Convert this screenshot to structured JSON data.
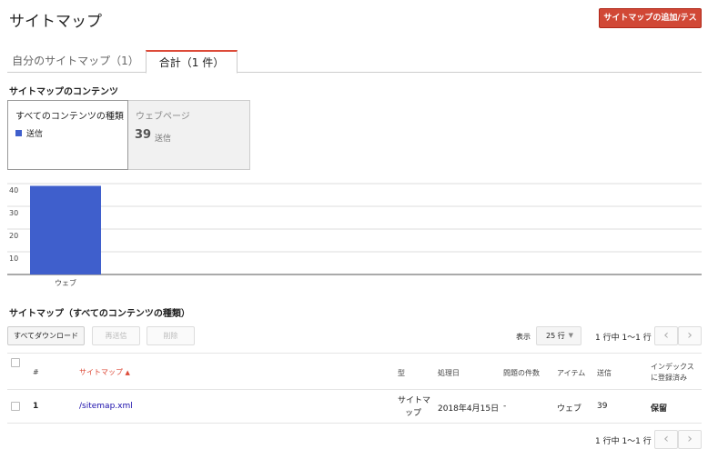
{
  "header": {
    "title": "サイトマップ",
    "add_button": "サイトマップの追加/テスト"
  },
  "tabs": [
    {
      "label": "自分のサイトマップ（1）"
    },
    {
      "label": "合計（1 件）"
    }
  ],
  "content_section": {
    "title": "サイトマップのコンテンツ",
    "cards": [
      {
        "label": "すべてのコンテンツの種類",
        "legend": "送信"
      },
      {
        "label": "ウェブページ",
        "count": "39",
        "unit": "送信"
      }
    ]
  },
  "chart_data": {
    "type": "bar",
    "categories": [
      "ウェブ"
    ],
    "series": [
      {
        "name": "送信",
        "values": [
          39
        ]
      }
    ],
    "yticks": [
      10,
      20,
      30,
      40
    ],
    "ylim": [
      0,
      40
    ],
    "color": "#3f5fcc",
    "grid": true
  },
  "table_section": {
    "title": "サイトマップ（すべてのコンテンツの種類）",
    "buttons": {
      "download": "すべてダウンロード",
      "resend": "再送信",
      "delete": "削除"
    },
    "show_label": "表示",
    "rows_per_page": "25 行",
    "pager_text": "1 行中 1～1 行",
    "columns": {
      "num": "#",
      "sitemap": "サイトマップ",
      "type": "型",
      "processed": "処理日",
      "issues": "問題の件数",
      "item": "アイテム",
      "submitted": "送信",
      "indexed_1": "インデックス",
      "indexed_2": "に登録済み"
    },
    "rows": [
      {
        "num": "1",
        "sitemap": "/sitemap.xml",
        "type_1": "サイトマ",
        "type_2": "ップ",
        "processed": "2018年4月15日",
        "issues": "-",
        "item": "ウェブ",
        "submitted": "39",
        "indexed": "保留"
      }
    ]
  }
}
